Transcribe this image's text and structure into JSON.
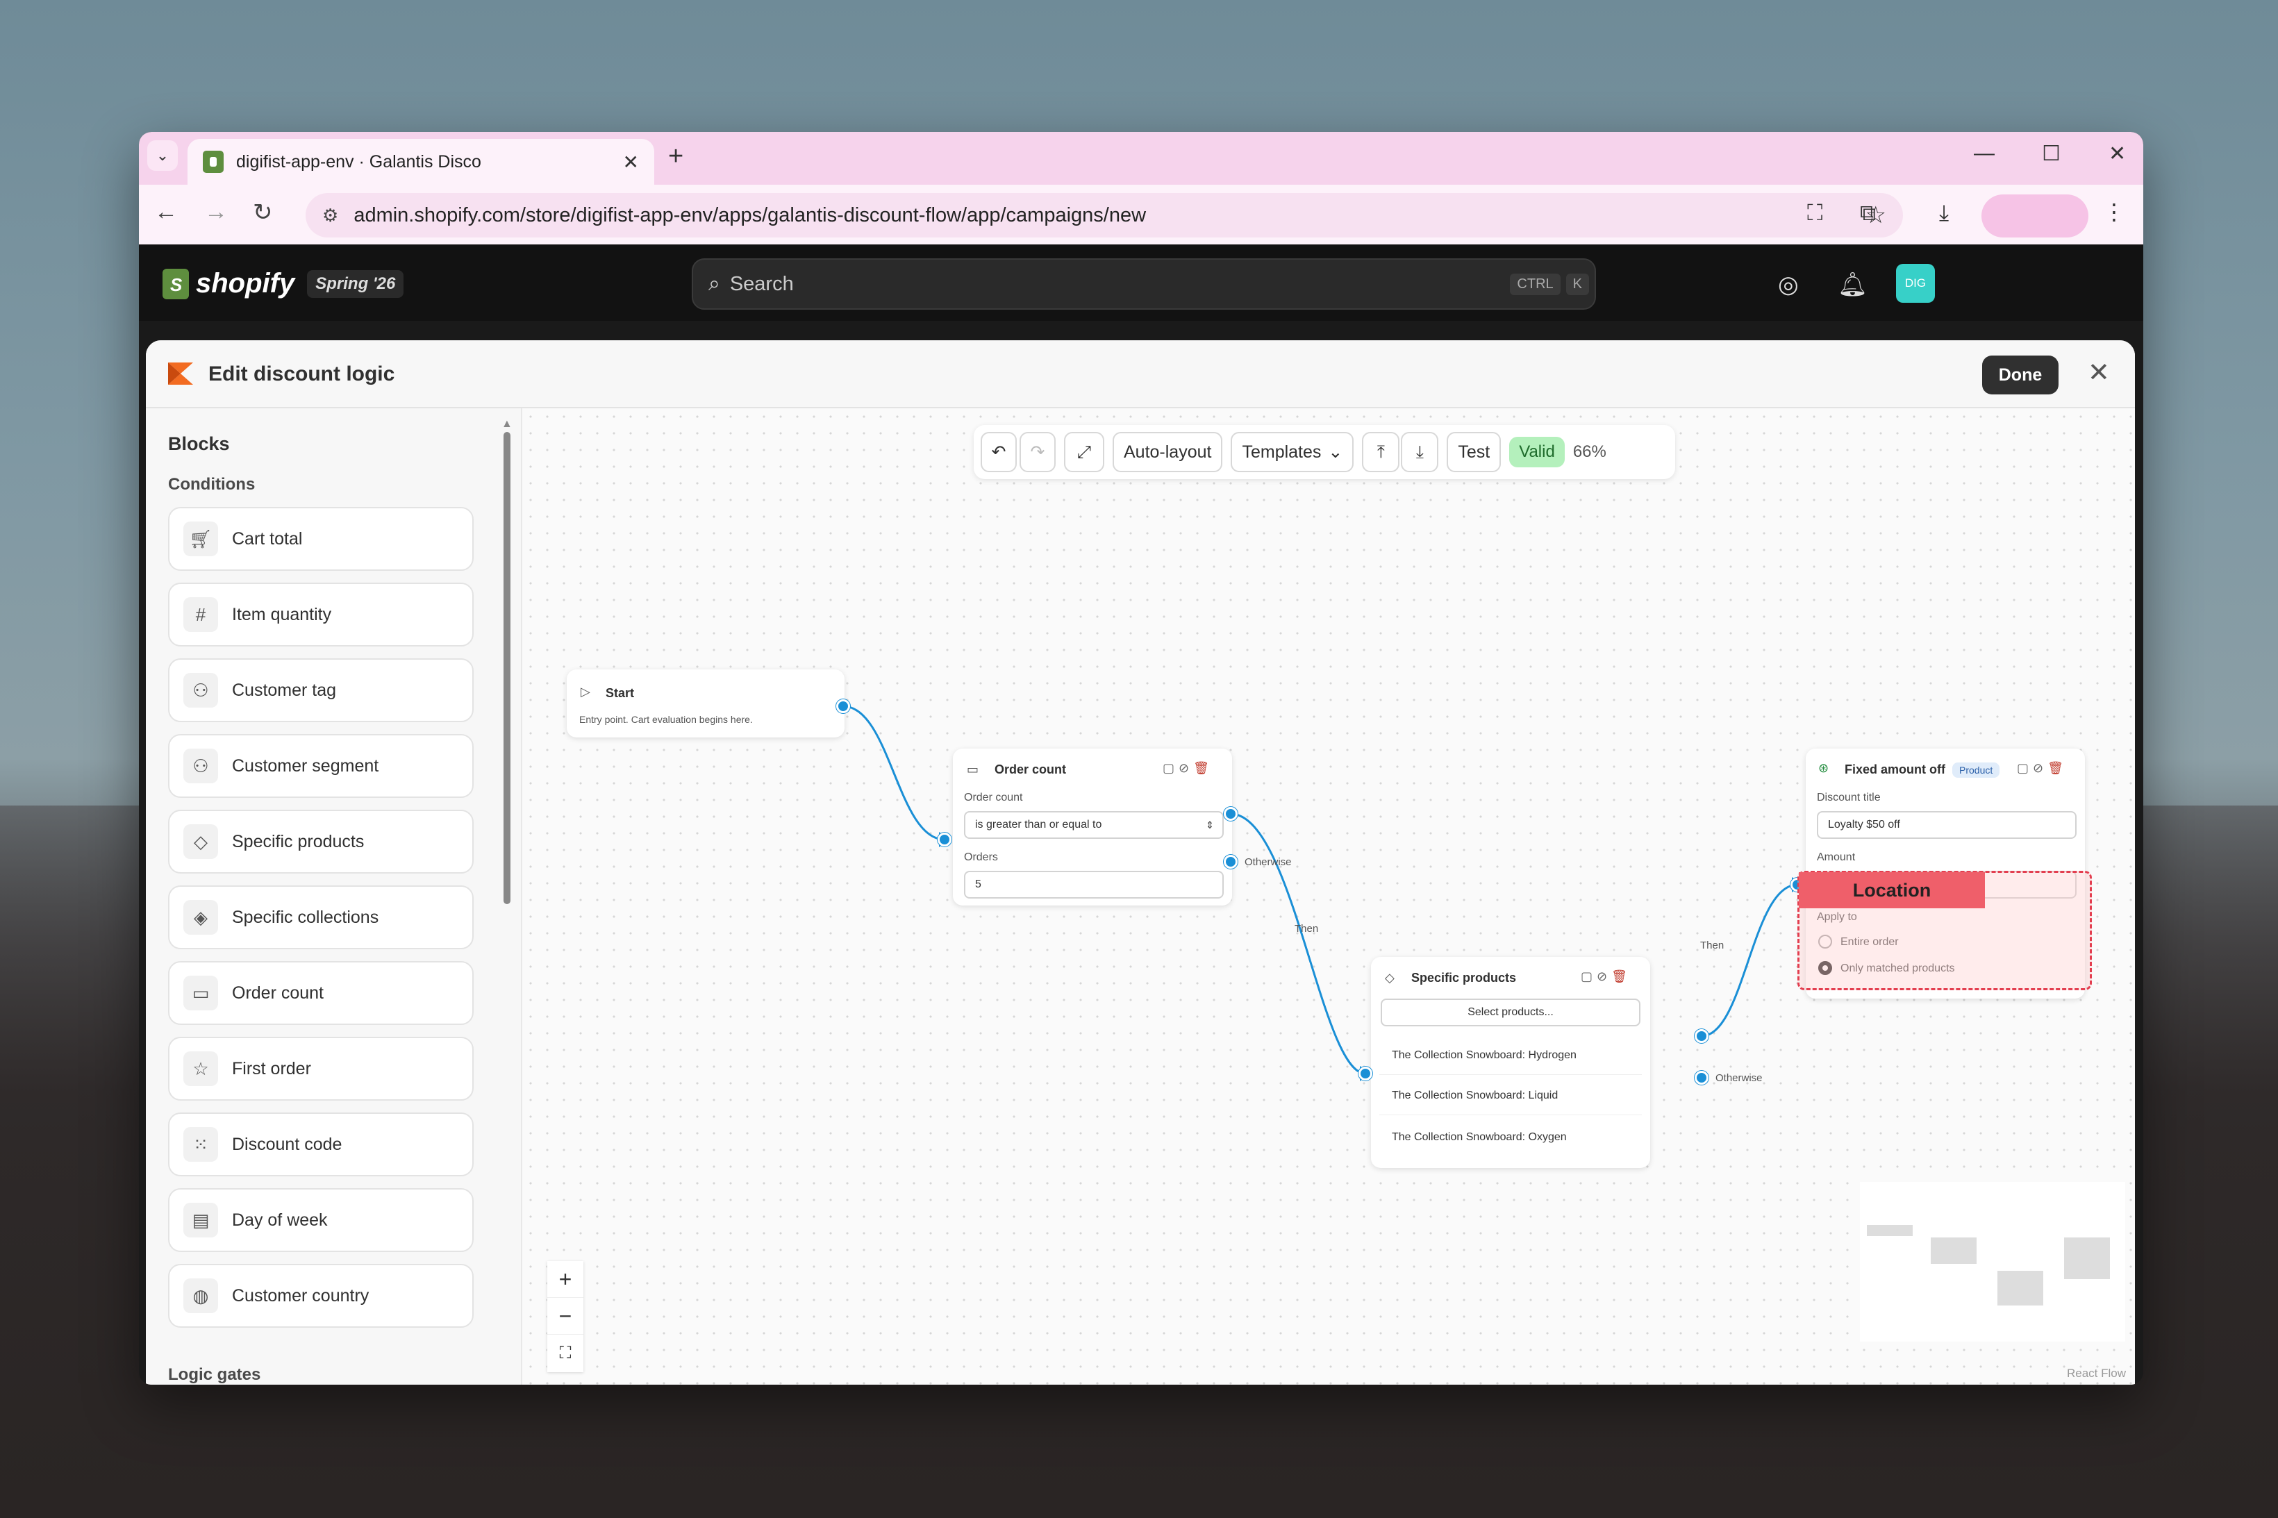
{
  "browser": {
    "tab_title": "digifist-app-env · Galantis Disco",
    "url": "admin.shopify.com/store/digifist-app-env/apps/galantis-discount-flow/app/campaigns/new"
  },
  "shopify": {
    "brand": "shopify",
    "edition": "Spring '26",
    "search_placeholder": "Search",
    "kbd_ctrl": "CTRL",
    "kbd_k": "K",
    "avatar_initials": "DIG"
  },
  "modal": {
    "title": "Edit discount logic",
    "done_label": "Done"
  },
  "sidebar": {
    "heading": "Blocks",
    "section": "Conditions",
    "items": [
      {
        "label": "Cart total",
        "icon": "cart-icon"
      },
      {
        "label": "Item quantity",
        "icon": "hash-icon"
      },
      {
        "label": "Customer tag",
        "icon": "person-icon"
      },
      {
        "label": "Customer segment",
        "icon": "person-list-icon"
      },
      {
        "label": "Specific products",
        "icon": "tag-icon"
      },
      {
        "label": "Specific collections",
        "icon": "collection-icon"
      },
      {
        "label": "Order count",
        "icon": "inbox-icon"
      },
      {
        "label": "First order",
        "icon": "star-icon"
      },
      {
        "label": "Discount code",
        "icon": "code-icon"
      },
      {
        "label": "Day of week",
        "icon": "calendar-icon"
      },
      {
        "label": "Customer country",
        "icon": "globe-icon"
      }
    ],
    "next_section": "Logic gates"
  },
  "toolbar": {
    "auto_layout": "Auto-layout",
    "templates": "Templates",
    "test": "Test",
    "valid": "Valid",
    "zoom": "66%"
  },
  "nodes": {
    "start": {
      "title": "Start",
      "desc": "Entry point. Cart evaluation begins here."
    },
    "order_count": {
      "title": "Order count",
      "field1_label": "Order count",
      "field1_value": "is greater than or equal to",
      "field2_label": "Orders",
      "field2_value": "5",
      "otherwise": "Otherwise"
    },
    "specific_products": {
      "title": "Specific products",
      "select_btn": "Select products...",
      "products": [
        "The Collection Snowboard: Hydrogen",
        "The Collection Snowboard: Liquid",
        "The Collection Snowboard: Oxygen"
      ],
      "otherwise": "Otherwise"
    },
    "fixed_amount": {
      "title": "Fixed amount off",
      "badge": "Product",
      "discount_title_label": "Discount title",
      "discount_title_value": "Loyalty $50 off",
      "amount_label": "Amount",
      "apply_to_label": "Apply to",
      "opt_entire": "Entire order",
      "opt_matched": "Only matched products"
    }
  },
  "edges": {
    "then1": "Then",
    "then2": "Then"
  },
  "annotation": {
    "label": "Location"
  },
  "attribution": "React Flow"
}
